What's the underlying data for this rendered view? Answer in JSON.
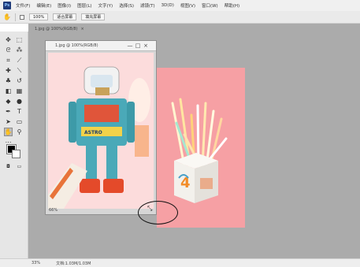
{
  "menubar": {
    "items": [
      "文件(F)",
      "编辑(E)",
      "图像(I)",
      "图层(L)",
      "文字(Y)",
      "选择(S)",
      "滤镜(T)",
      "3D(D)",
      "视图(V)",
      "窗口(W)",
      "帮助(H)"
    ]
  },
  "options": {
    "zoom_text": "100%",
    "fit_screen_label": "适合屏幕",
    "fill_screen_label": "填充屏幕"
  },
  "document": {
    "tab_label": "1.jpg @ 100%(RGB/8)",
    "title": "1.jpg @ 100%(RGB/8)",
    "zoom_text": "66%"
  },
  "status": {
    "zoom": "33%",
    "info": "文档:1.03M/1.03M"
  },
  "colors": {
    "foreground": "#000000",
    "background": "#ffffff",
    "workspace": "#ababab"
  }
}
